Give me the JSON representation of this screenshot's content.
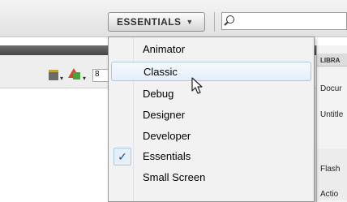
{
  "workspace": {
    "label": "ESSENTIALS",
    "caret": "▼"
  },
  "search": {
    "placeholder": ""
  },
  "menu": {
    "items": [
      {
        "label": "Animator",
        "checked": false,
        "hovered": false
      },
      {
        "label": "Classic",
        "checked": false,
        "hovered": true
      },
      {
        "label": "Debug",
        "checked": false,
        "hovered": false
      },
      {
        "label": "Designer",
        "checked": false,
        "hovered": false
      },
      {
        "label": "Developer",
        "checked": false,
        "hovered": false
      },
      {
        "label": "Essentials",
        "checked": true,
        "hovered": false
      },
      {
        "label": "Small Screen",
        "checked": false,
        "hovered": false
      }
    ],
    "check_glyph": "✓"
  },
  "toolbar": {
    "zoom_value": "8"
  },
  "library_panel": {
    "header": "LIBRA",
    "items": [
      "Docur",
      "Untitle",
      "Flash",
      "Actio"
    ]
  },
  "icons": {
    "search": "search-icon",
    "clapper": "clapperboard-icon",
    "shapes": "shapes-icon",
    "cursor": "mouse-cursor-icon"
  }
}
